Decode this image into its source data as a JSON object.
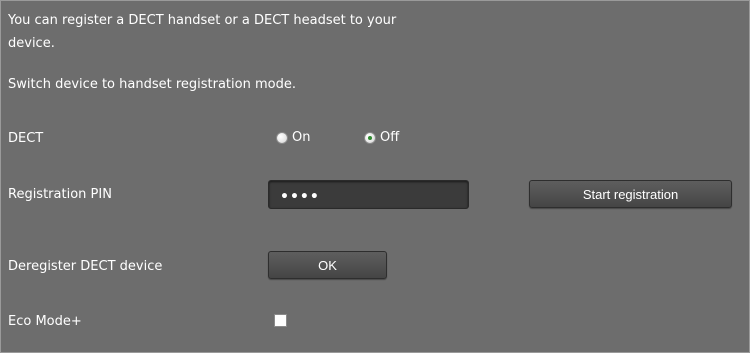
{
  "intro": {
    "text": "You can register a DECT handset or a DECT headset to your device.",
    "instruction": "Switch device to handset registration mode."
  },
  "dect": {
    "label": "DECT",
    "options": [
      {
        "label": "On",
        "checked": false
      },
      {
        "label": "Off",
        "checked": true
      }
    ]
  },
  "registration": {
    "pin_label": "Registration PIN",
    "pin_value": "••••",
    "start_button_label": "Start registration"
  },
  "deregister": {
    "label": "Deregister DECT device",
    "button_label": "OK"
  },
  "eco_mode": {
    "label": "Eco Mode+",
    "checked": false
  },
  "colors": {
    "background": "#6d6d6d",
    "input_background": "#3b3b3b",
    "radio_selected": "#2f8a2f"
  }
}
